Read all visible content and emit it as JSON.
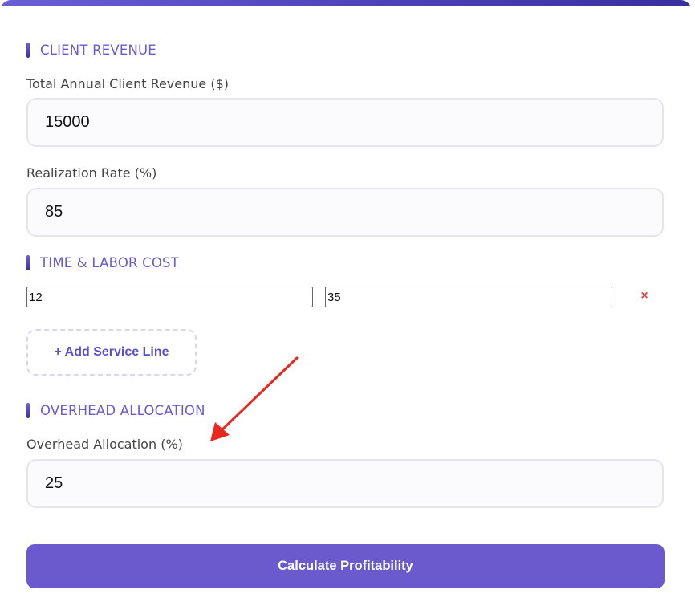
{
  "sections": {
    "revenue": "CLIENT REVENUE",
    "labor": "TIME & LABOR COST",
    "overhead": "OVERHEAD ALLOCATION"
  },
  "fields": {
    "revenue_label": "Total Annual Client Revenue ($)",
    "revenue_value": "15000",
    "realization_label": "Realization Rate (%)",
    "realization_value": "85",
    "overhead_label": "Overhead Allocation (%)",
    "overhead_value": "25"
  },
  "service_lines": [
    {
      "hours": "12",
      "rate": "35",
      "remove_glyph": "×"
    }
  ],
  "buttons": {
    "add_service": "+ Add Service Line",
    "calculate": "Calculate Profitability"
  },
  "colors": {
    "accent": "#6a5acd",
    "remove": "#e0463c",
    "arrow": "#e8281e"
  }
}
